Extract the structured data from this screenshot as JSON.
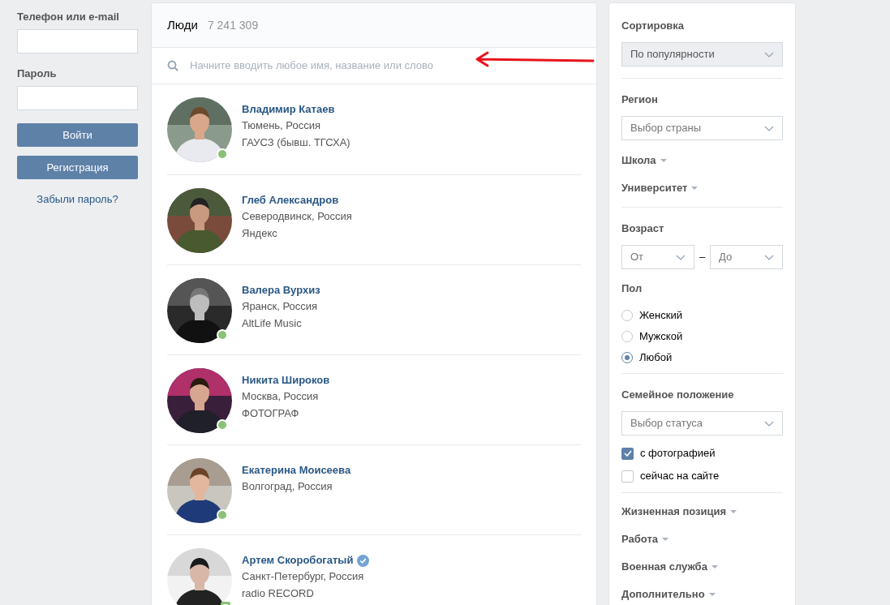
{
  "login": {
    "phone_label": "Телефон или e-mail",
    "password_label": "Пароль",
    "buttons": [
      "Войти",
      "Регистрация"
    ],
    "forgot_link": "Забыли пароль?"
  },
  "people": {
    "title": "Люди",
    "count": "7 241 309",
    "search": {
      "placeholder": "Начните вводить любое имя, название или слово"
    },
    "items": [
      {
        "name": "Владимир Катаев",
        "city": "Тюмень, Россия",
        "extra": "ГАУСЗ (бывш. ТГСХА)",
        "online": true,
        "mobile": false,
        "verified": false
      },
      {
        "name": "Глеб Александров",
        "city": "Северодвинск, Россия",
        "extra": "Яндекс",
        "online": false,
        "verified": false
      },
      {
        "name": "Валера Вурхиз",
        "city": "Яранск, Россия",
        "extra": "AltLife Music",
        "online": true,
        "mobile": false,
        "verified": false
      },
      {
        "name": "Никита Широков",
        "city": "Москва, Россия",
        "extra": "ФОТОГРАФ",
        "online": true,
        "mobile": false,
        "verified": false
      },
      {
        "name": "Екатерина Моисеева",
        "city": "Волгоград, Россия",
        "online": true,
        "mobile": false,
        "verified": false
      },
      {
        "name": "Артем Скоробогатый",
        "city": "Санкт-Петербург, Россия",
        "extra": "radio RECORD",
        "online": true,
        "mobile": true,
        "verified": true
      }
    ]
  },
  "filters": [
    [
      {
        "kind": "heading",
        "text": "Сортировка"
      },
      {
        "kind": "select",
        "text": "По популярности",
        "disabled": true
      }
    ],
    [
      {
        "kind": "heading",
        "text": "Регион"
      },
      {
        "kind": "select",
        "text": "Выбор страны",
        "disabled": false
      },
      {
        "kind": "expander",
        "text": "Школа"
      },
      {
        "kind": "expander",
        "text": "Университет"
      }
    ],
    [
      {
        "kind": "heading",
        "text": "Возраст"
      },
      {
        "kind": "range",
        "from": "От",
        "separator": "–",
        "to": "До"
      },
      {
        "kind": "heading",
        "text": "Пол"
      },
      {
        "kind": "radio",
        "text": "Женский",
        "selected": false
      },
      {
        "kind": "radio",
        "text": "Мужской",
        "selected": false
      },
      {
        "kind": "radio",
        "text": "Любой",
        "selected": true
      }
    ],
    [
      {
        "kind": "heading",
        "text": "Семейное положение"
      },
      {
        "kind": "select",
        "text": "Выбор статуса",
        "disabled": false
      },
      {
        "kind": "checkbox",
        "text": "с фотографией",
        "checked": true
      },
      {
        "kind": "checkbox",
        "text": "сейчас на сайте",
        "checked": false
      }
    ],
    [
      {
        "kind": "expander",
        "text": "Жизненная позиция"
      },
      {
        "kind": "expander",
        "text": "Работа"
      },
      {
        "kind": "expander",
        "text": "Военная служба"
      },
      {
        "kind": "expander",
        "text": "Дополнительно"
      }
    ]
  ]
}
